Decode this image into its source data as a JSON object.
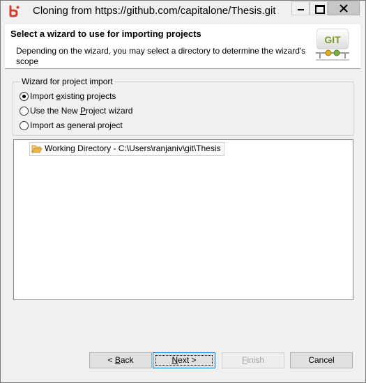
{
  "window": {
    "title": "Cloning from https://github.com/capitalone/Thesis.git"
  },
  "banner": {
    "title": "Select a wizard to use for importing projects",
    "description": "Depending on the wizard, you may select a directory to determine the wizard's scope",
    "logo_text": "GIT"
  },
  "wizard_group": {
    "label": "Wizard for project import",
    "options": [
      {
        "label": "Import existing projects",
        "selected": true
      },
      {
        "label": "Use the New Project wizard",
        "selected": false
      },
      {
        "label": "Import as general project",
        "selected": false
      }
    ]
  },
  "tree": {
    "items": [
      {
        "label": "Working Directory - C:\\Users\\ranjaniv\\git\\Thesis",
        "icon": "folder-open-icon"
      }
    ]
  },
  "buttons": {
    "back": "< Back",
    "next": "Next >",
    "finish": "Finish",
    "cancel": "Cancel"
  },
  "colors": {
    "accent_border": "#0078d7",
    "folder": "#e8b84a"
  }
}
